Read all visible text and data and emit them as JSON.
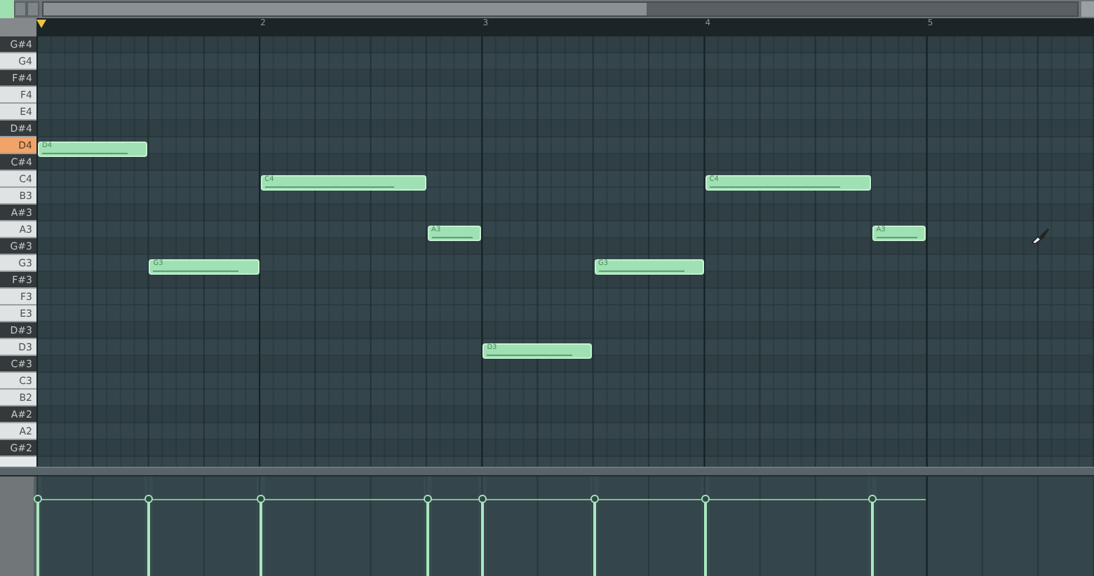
{
  "ruler": {
    "bar_numbers": [
      "2",
      "3",
      "4",
      "5"
    ]
  },
  "keys": [
    {
      "label": "G#4",
      "kind": "black",
      "selected": false
    },
    {
      "label": "G4",
      "kind": "white",
      "selected": false
    },
    {
      "label": "F#4",
      "kind": "black",
      "selected": false
    },
    {
      "label": "F4",
      "kind": "white",
      "selected": false
    },
    {
      "label": "E4",
      "kind": "white",
      "selected": false
    },
    {
      "label": "D#4",
      "kind": "black",
      "selected": false
    },
    {
      "label": "D4",
      "kind": "white",
      "selected": true
    },
    {
      "label": "C#4",
      "kind": "black",
      "selected": false
    },
    {
      "label": "C4",
      "kind": "white",
      "selected": false
    },
    {
      "label": "B3",
      "kind": "white",
      "selected": false
    },
    {
      "label": "A#3",
      "kind": "black",
      "selected": false
    },
    {
      "label": "A3",
      "kind": "white",
      "selected": false
    },
    {
      "label": "G#3",
      "kind": "black",
      "selected": false
    },
    {
      "label": "G3",
      "kind": "white",
      "selected": false
    },
    {
      "label": "F#3",
      "kind": "black",
      "selected": false
    },
    {
      "label": "F3",
      "kind": "white",
      "selected": false
    },
    {
      "label": "E3",
      "kind": "white",
      "selected": false
    },
    {
      "label": "D#3",
      "kind": "black",
      "selected": false
    },
    {
      "label": "D3",
      "kind": "white",
      "selected": false
    },
    {
      "label": "C#3",
      "kind": "black",
      "selected": false
    },
    {
      "label": "C3",
      "kind": "white",
      "selected": false
    },
    {
      "label": "B2",
      "kind": "white",
      "selected": false
    },
    {
      "label": "A#2",
      "kind": "black",
      "selected": false
    },
    {
      "label": "A2",
      "kind": "white",
      "selected": false
    },
    {
      "label": "G#2",
      "kind": "black",
      "selected": false
    }
  ],
  "notes": [
    {
      "label": "D4",
      "level": 0.78
    },
    {
      "label": "G3",
      "level": 0.78
    },
    {
      "label": "C4",
      "level": 0.78
    },
    {
      "label": "A3",
      "level": 0.78
    },
    {
      "label": "D3",
      "level": 0.78
    },
    {
      "label": "G3",
      "level": 0.78
    },
    {
      "label": "C4",
      "level": 0.78
    },
    {
      "label": "A3",
      "level": 0.78
    }
  ]
}
